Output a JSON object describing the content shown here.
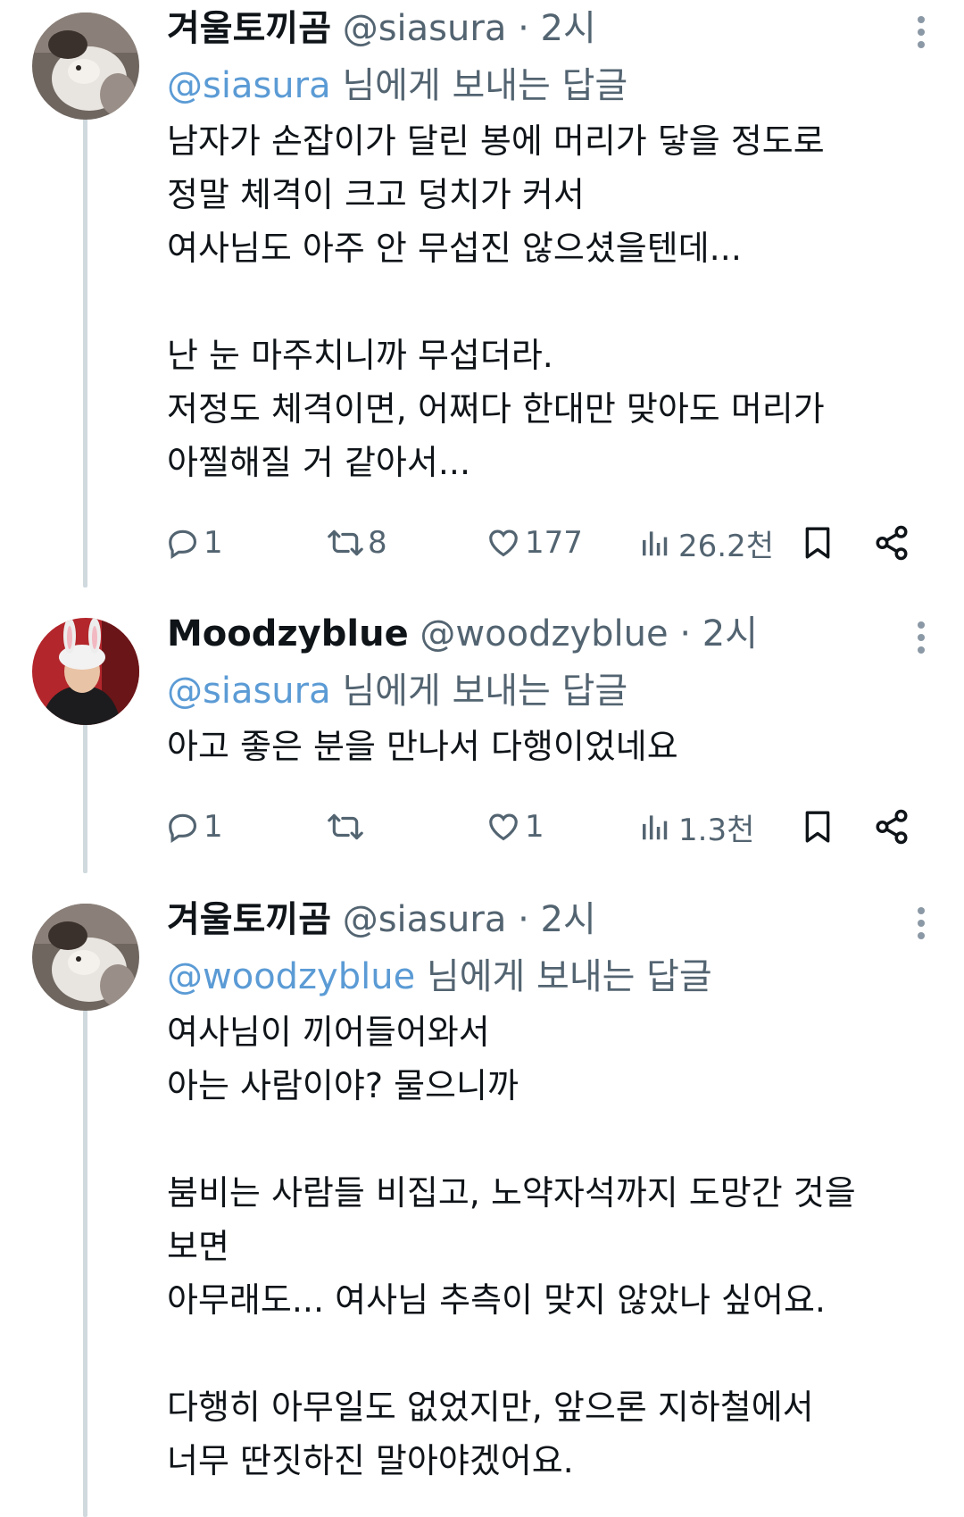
{
  "tweets": [
    {
      "name": "겨울토끼곰",
      "handle": "@siasura",
      "separator": "·",
      "time": "2시",
      "reply_prefix": "@siasura",
      "reply_suffix": " 님에게 보내는 답글",
      "lines": [
        "남자가 손잡이가 달린 봉에 머리가 닿을 정도로",
        "정말 체격이 크고 덩치가 커서",
        "여사님도 아주 안 무섭진 않으셨을텐데...",
        "",
        "난 눈 마주치니까 무섭더라.",
        "저정도 체격이면, 어쩌다 한대만 맞아도 머리가",
        "아찔해질 거 같아서..."
      ],
      "stats": {
        "replies": "1",
        "retweets": "8",
        "likes": "177",
        "views": "26.2천"
      },
      "avatar_icon": "rabbit-photo-avatar"
    },
    {
      "name": "Moodzyblue",
      "handle": "@woodzyblue",
      "separator": "·",
      "time": "2시",
      "reply_prefix": "@siasura",
      "reply_suffix": " 님에게 보내는 답글",
      "lines": [
        "아고 좋은 분을 만나서 다행이었네요"
      ],
      "stats": {
        "replies": "1",
        "retweets": "",
        "likes": "1",
        "views": "1.3천"
      },
      "avatar_icon": "bunny-ears-person-avatar"
    },
    {
      "name": "겨울토끼곰",
      "handle": "@siasura",
      "separator": "·",
      "time": "2시",
      "reply_prefix": "@woodzyblue",
      "reply_suffix": " 님에게 보내는 답글",
      "lines": [
        "여사님이 끼어들어와서",
        "아는 사람이야? 물으니까",
        "",
        "붐비는 사람들 비집고, 노약자석까지 도망간 것을",
        "보면",
        "아무래도... 여사님 추측이 맞지 않았나 싶어요.",
        "",
        "다행히 아무일도 없었지만, 앞으론 지하철에서",
        "너무 딴짓하진 말아야겠어요."
      ],
      "stats": null,
      "avatar_icon": "rabbit-photo-avatar"
    }
  ],
  "colors": {
    "mention": "#5b9bd5",
    "secondary_text": "#536471",
    "thread_line": "#cfd9de"
  }
}
